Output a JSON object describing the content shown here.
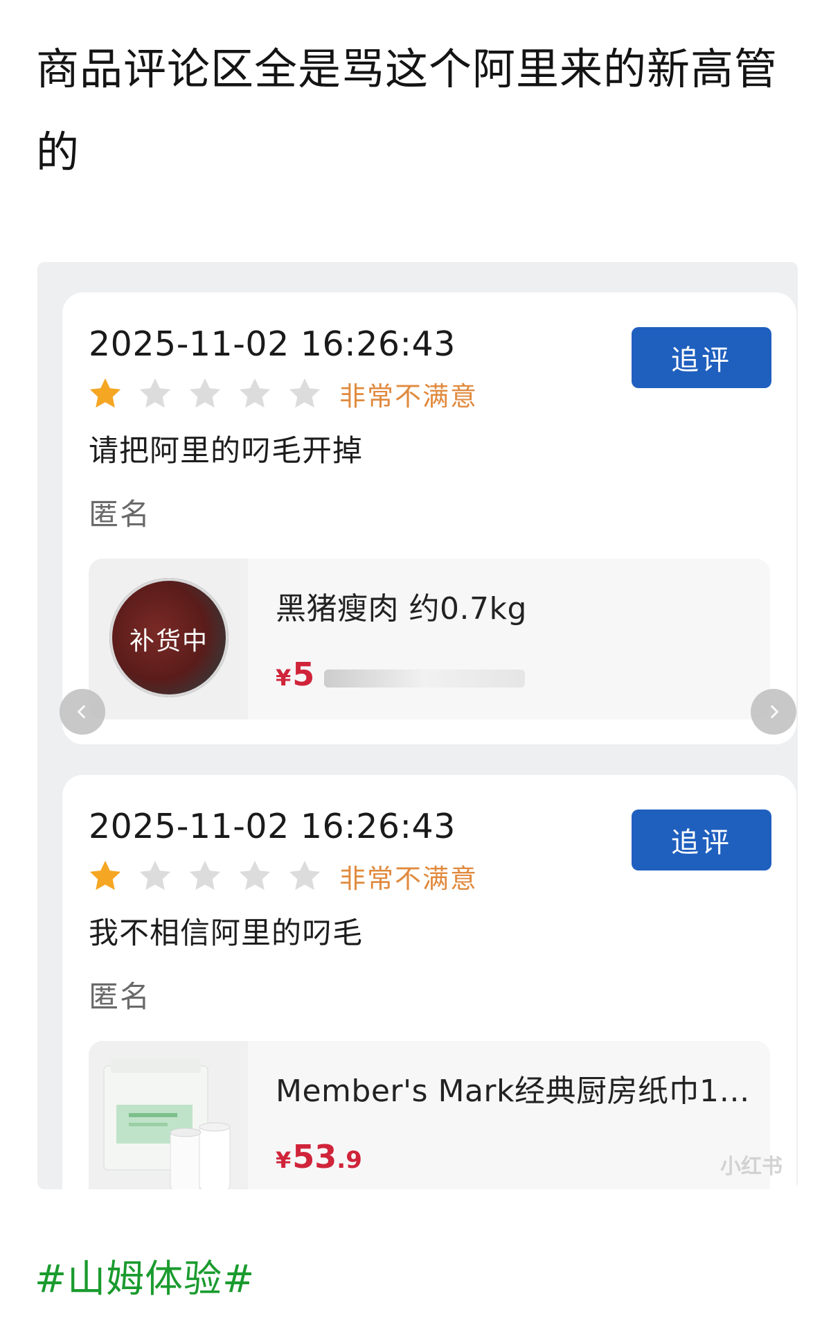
{
  "post": {
    "title": "商品评论区全是骂这个阿里来的新高管的",
    "hashtag": "#山姆体验#"
  },
  "reviews": [
    {
      "timestamp": "2025-11-02 16:26:43",
      "follow_label": "追评",
      "rating": 1,
      "rating_max": 5,
      "rating_text": "非常不满意",
      "text": "请把阿里的叼毛开掉",
      "author": "匿名",
      "product": {
        "name": "黑猪瘦肉 约0.7kg",
        "badge": "补货中",
        "price_prefix": "¥",
        "price_visible": "5",
        "image": "meat-thumbnail"
      }
    },
    {
      "timestamp": "2025-11-02 16:26:43",
      "follow_label": "追评",
      "rating": 1,
      "rating_max": 5,
      "rating_text": "非常不满意",
      "text": "我不相信阿里的叼毛",
      "author": "匿名",
      "product": {
        "name": "Member's Mark经典厨房纸巾1…",
        "price_prefix": "¥",
        "price_main": "53",
        "price_decimal": ".9",
        "image": "paper-towel-thumbnail"
      }
    }
  ],
  "icons": {
    "star_filled_color": "#f5a623",
    "star_empty_color": "#dcdcdc",
    "button_color": "#1f5fbe",
    "rating_text_color": "#e08a3e",
    "price_color": "#d0243a",
    "hashtag_color": "#1a9b2e"
  },
  "watermark": "小红书"
}
